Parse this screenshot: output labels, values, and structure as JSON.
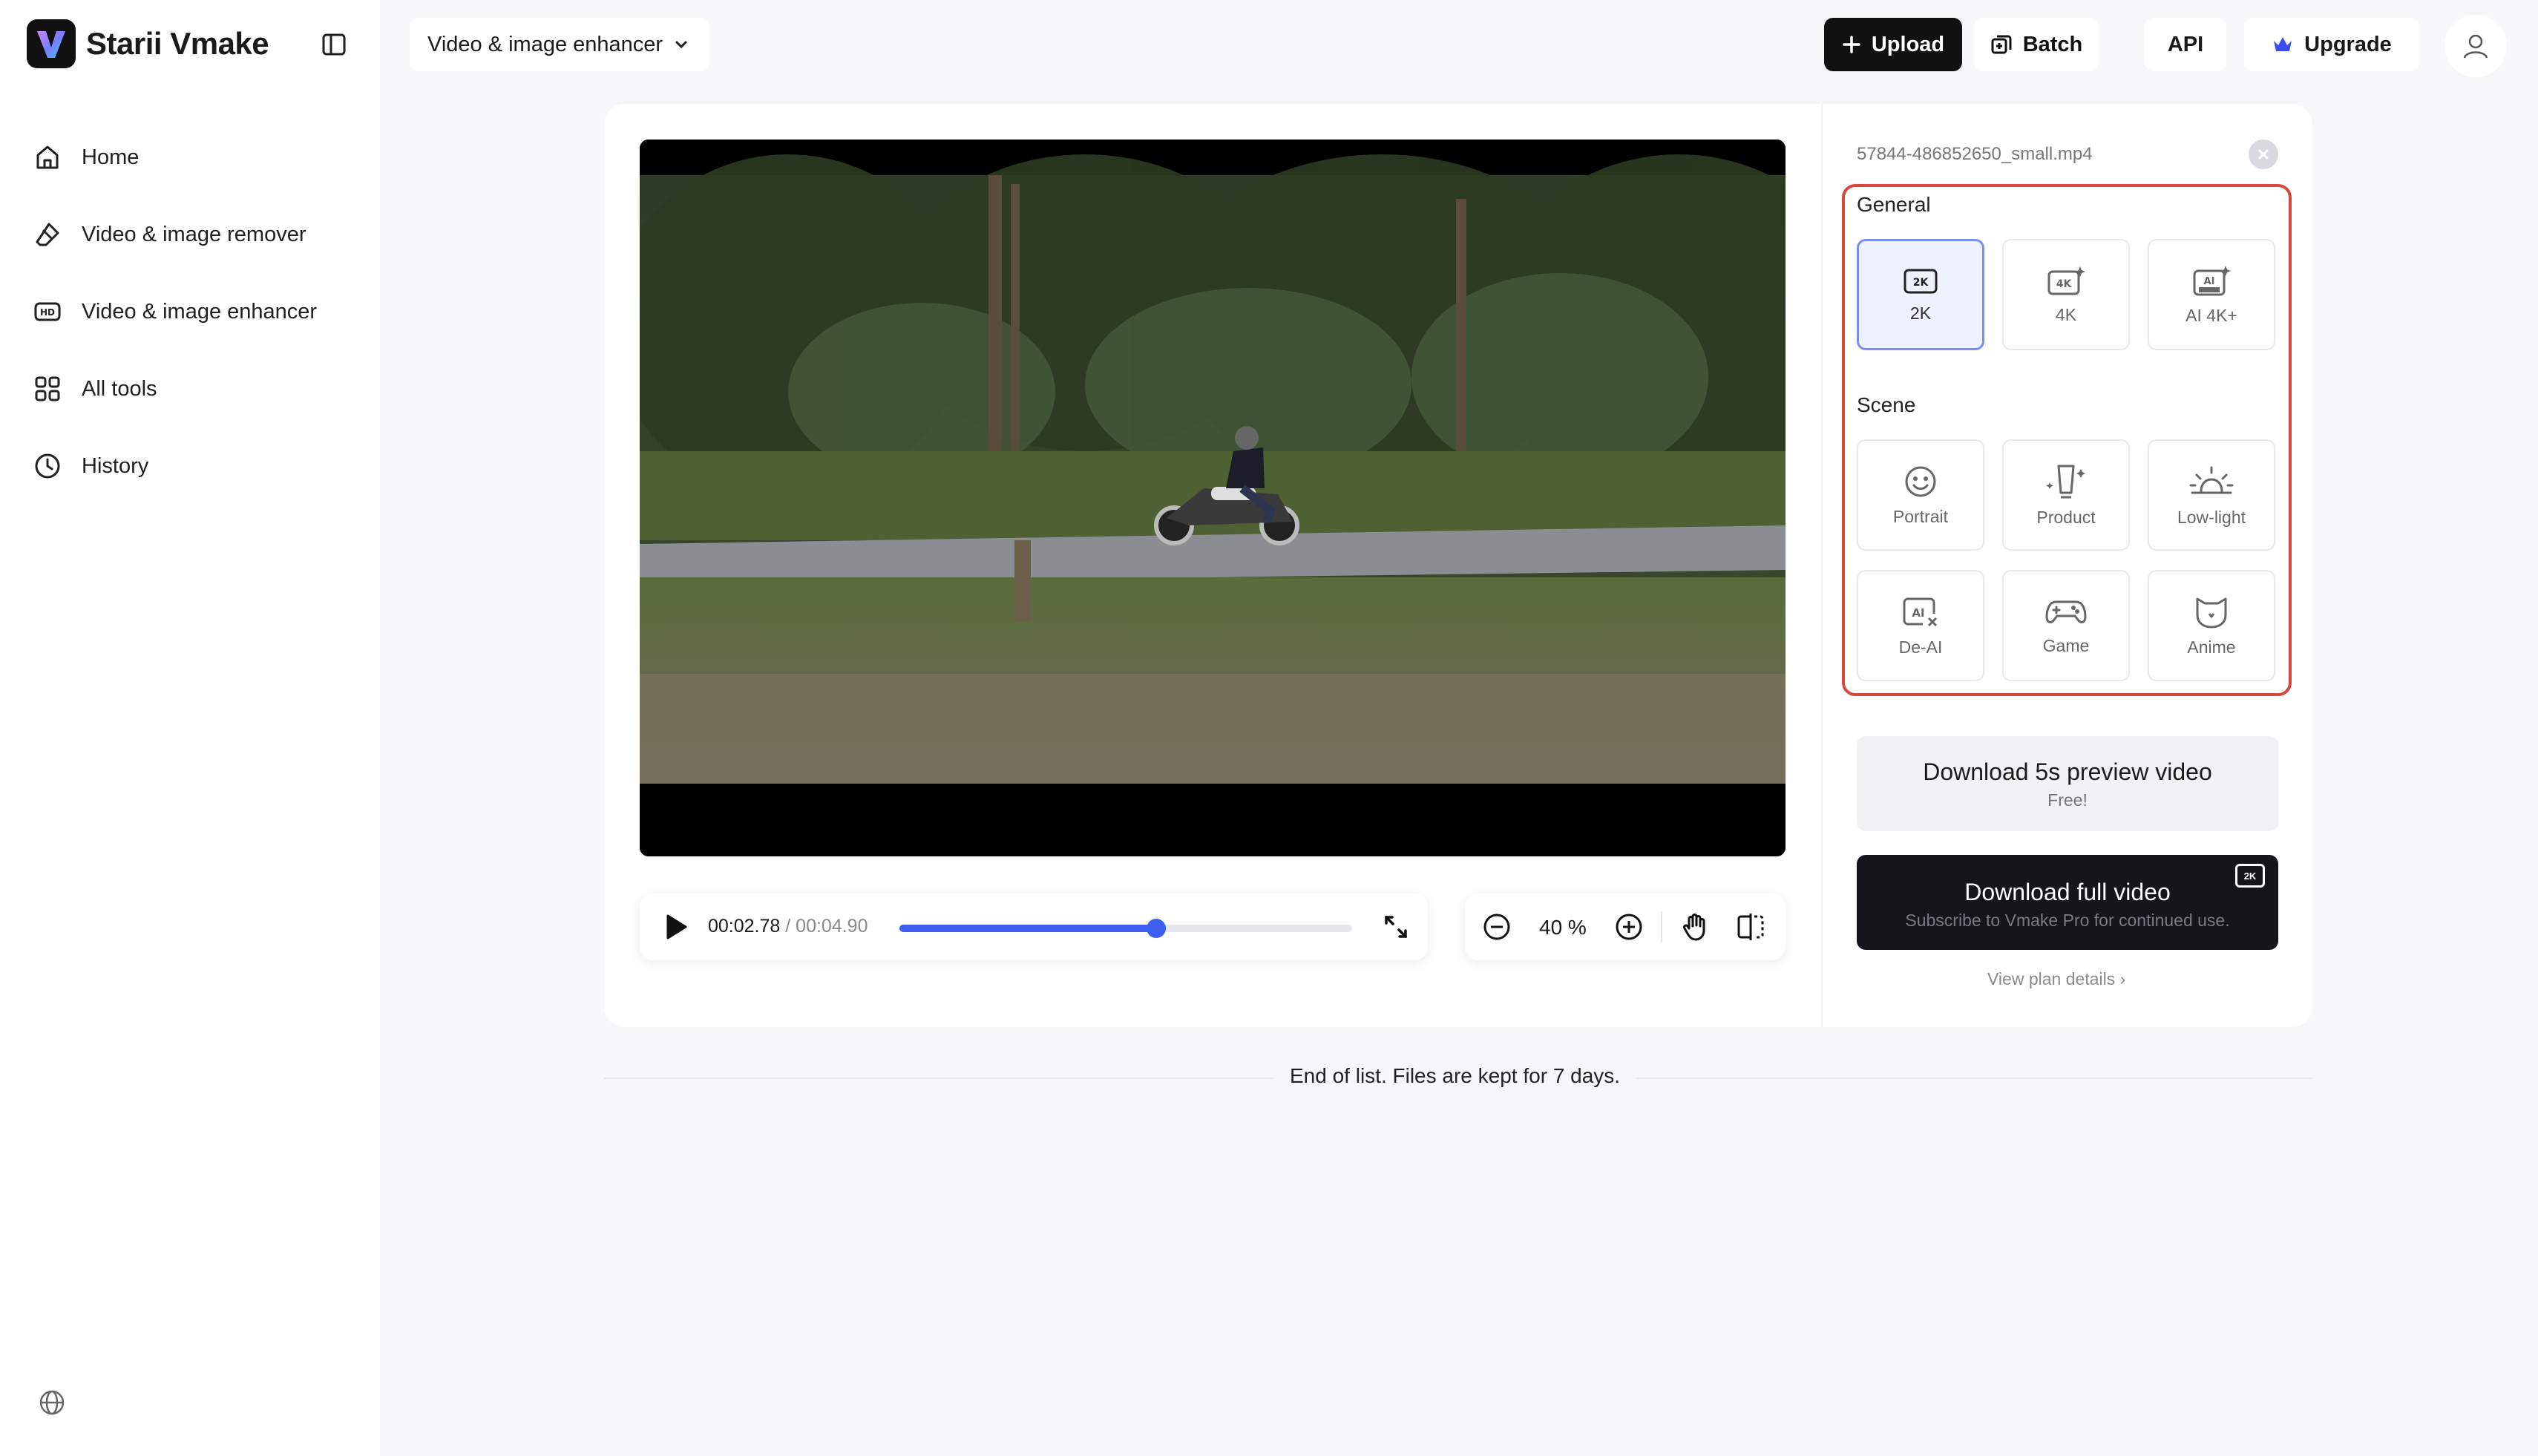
{
  "app": {
    "name": "Starii Vmake"
  },
  "sidebar": {
    "items": [
      {
        "label": "Home",
        "icon": "home-icon"
      },
      {
        "label": "Video & image remover",
        "icon": "eraser-icon"
      },
      {
        "label": "Video & image enhancer",
        "icon": "hd-icon"
      },
      {
        "label": "All tools",
        "icon": "grid-icon"
      },
      {
        "label": "History",
        "icon": "clock-icon"
      }
    ]
  },
  "header": {
    "tool_select": "Video & image enhancer",
    "upload_label": "Upload",
    "batch_label": "Batch",
    "api_label": "API",
    "upgrade_label": "Upgrade"
  },
  "player": {
    "current_time": "00:02.78",
    "total_time": "/ 00:04.90",
    "progress": 0.567,
    "zoom": "40 %"
  },
  "panel": {
    "file_name": "57844-486852650_small.mp4",
    "general_title": "General",
    "general": [
      {
        "label": "2K",
        "selected": true
      },
      {
        "label": "4K",
        "selected": false
      },
      {
        "label": "AI 4K+",
        "selected": false
      }
    ],
    "scene_title": "Scene",
    "scene": [
      {
        "label": "Portrait"
      },
      {
        "label": "Product"
      },
      {
        "label": "Low-light"
      },
      {
        "label": "De-AI"
      },
      {
        "label": "Game"
      },
      {
        "label": "Anime"
      }
    ],
    "preview_title": "Download 5s preview video",
    "preview_sub": "Free!",
    "full_title": "Download full video",
    "full_sub": "Subscribe to Vmake Pro for continued use.",
    "full_badge": "2K",
    "plan_link": "View plan details ›"
  },
  "footer": {
    "end_text": "End of list. Files are kept for 7 days."
  },
  "colors": {
    "accent": "#3f5ef0",
    "highlight": "#d9463b",
    "dark": "#15161a"
  }
}
